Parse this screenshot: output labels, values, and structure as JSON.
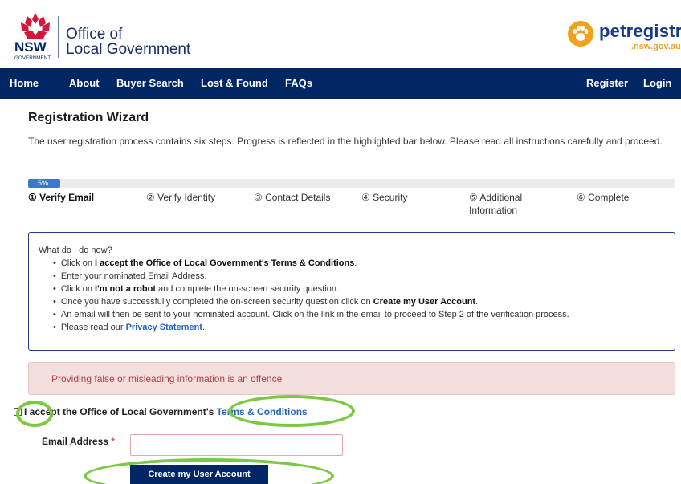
{
  "header": {
    "nsw_logo_text": "NSW",
    "nsw_logo_sub": "GOVERNMENT",
    "olg_line1": "Office of",
    "olg_line2": "Local Government",
    "pet_name": "petregistr",
    "pet_sub": ".nsw.gov.au"
  },
  "nav": {
    "home": "Home",
    "about": "About",
    "buyer_search": "Buyer Search",
    "lost_found": "Lost & Found",
    "faqs": "FAQs",
    "register": "Register",
    "login": "Login"
  },
  "wizard": {
    "title": "Registration Wizard",
    "intro": "The user registration process contains six steps. Progress is reflected in the highlighted bar below. Please read all instructions carefully and proceed.",
    "progress_label": "5%",
    "progress_fraction": 0.05,
    "steps": [
      "① Verify Email",
      "② Verify Identity",
      "③ Contact Details",
      "④ Security",
      "⑤ Additional Information",
      "⑥ Complete"
    ]
  },
  "instructions": {
    "heading": "What do I do now?",
    "item1_pre": "Click on ",
    "item1_bold": "I accept the Office of Local Government's Terms & Conditions",
    "item1_post": ".",
    "item2": "Enter your nominated Email Address.",
    "item3_pre": "Click on ",
    "item3_bold": "I'm not a robot",
    "item3_post": " and complete the on-screen security question.",
    "item4_pre": "Once you have successfully completed the on-screen security question click on ",
    "item4_bold": "Create my User Account",
    "item4_post": ".",
    "item5": "An email will then be sent to your nominated account. Click on the link in the email to proceed to Step 2 of the verification process.",
    "item6_pre": "Please read our ",
    "item6_link": "Privacy Statement",
    "item6_post": "."
  },
  "alert": {
    "text": "Providing false or misleading information is an offence"
  },
  "form": {
    "accept_text": "I accept the Office of Local Government's ",
    "terms_link": "Terms & Conditions",
    "email_label": "Email Address",
    "required_mark": "*",
    "email_value": "",
    "submit_label": "Create my User Account"
  },
  "colors": {
    "navy": "#002664",
    "progress": "#3c77cc",
    "link": "#2565b8",
    "alert_bg": "#f3dede",
    "alert_text": "#a94442",
    "highlight_ring": "#7bc943"
  }
}
